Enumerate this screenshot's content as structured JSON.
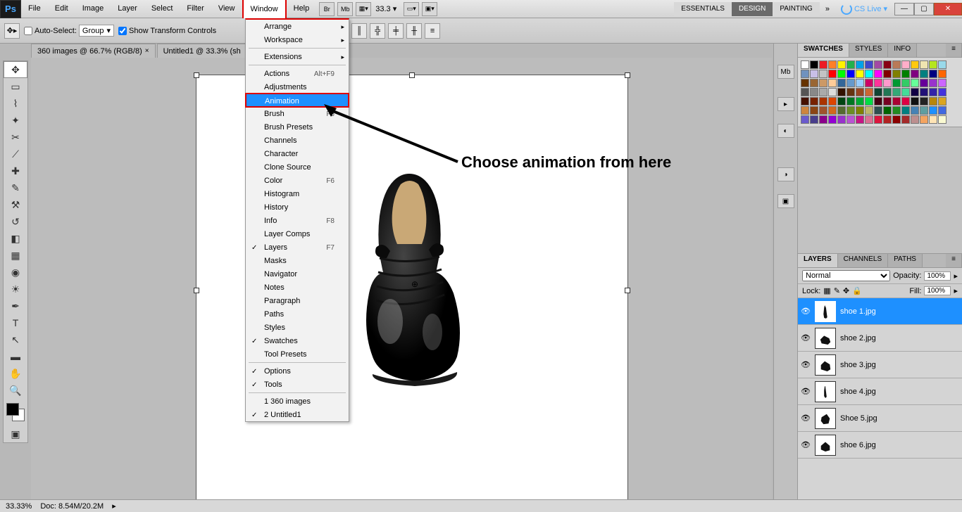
{
  "menubar": {
    "items": [
      "File",
      "Edit",
      "Image",
      "Layer",
      "Select",
      "Filter",
      "View",
      "Window",
      "Help"
    ],
    "active_index": 7,
    "zoom_display": "33.3",
    "workspaces": [
      "ESSENTIALS",
      "DESIGN",
      "PAINTING"
    ],
    "active_workspace_index": 1,
    "cslive": "CS Live",
    "br_icon": "Br",
    "mb_icon": "Mb"
  },
  "optbar": {
    "auto_select": "Auto-Select:",
    "group": "Group",
    "show_transform": "Show Transform Controls"
  },
  "doctabs": [
    {
      "label": "360 images @ 66.7% (RGB/8)"
    },
    {
      "label": "Untitled1 @ 33.3% (sh"
    }
  ],
  "dropdown": {
    "sections": [
      [
        {
          "label": "Arrange",
          "sub": true
        },
        {
          "label": "Workspace",
          "sub": true
        }
      ],
      [
        {
          "label": "Extensions",
          "sub": true
        }
      ],
      [
        {
          "label": "Actions",
          "shortcut": "Alt+F9"
        },
        {
          "label": "Adjustments"
        },
        {
          "label": "Animation",
          "highlight": true
        },
        {
          "label": "Brush",
          "shortcut": "F5"
        },
        {
          "label": "Brush Presets"
        },
        {
          "label": "Channels"
        },
        {
          "label": "Character"
        },
        {
          "label": "Clone Source"
        },
        {
          "label": "Color",
          "shortcut": "F6"
        },
        {
          "label": "Histogram"
        },
        {
          "label": "History"
        },
        {
          "label": "Info",
          "shortcut": "F8"
        },
        {
          "label": "Layer Comps"
        },
        {
          "label": "Layers",
          "shortcut": "F7",
          "check": true
        },
        {
          "label": "Masks"
        },
        {
          "label": "Navigator"
        },
        {
          "label": "Notes"
        },
        {
          "label": "Paragraph"
        },
        {
          "label": "Paths"
        },
        {
          "label": "Styles"
        },
        {
          "label": "Swatches",
          "check": true
        },
        {
          "label": "Tool Presets"
        }
      ],
      [
        {
          "label": "Options",
          "check": true
        },
        {
          "label": "Tools",
          "check": true
        }
      ],
      [
        {
          "label": "1 360 images"
        },
        {
          "label": "2 Untitled1",
          "check": true
        }
      ]
    ]
  },
  "annotation": "Choose animation from here",
  "swatches_panel": {
    "tabs": [
      "SWATCHES",
      "STYLES",
      "INFO"
    ],
    "colors": [
      "#ffffff",
      "#000000",
      "#ed1c24",
      "#ff7f27",
      "#fff200",
      "#22b14c",
      "#00a2e8",
      "#3f48cc",
      "#a349a4",
      "#880015",
      "#b97a57",
      "#ffaec9",
      "#ffc90e",
      "#efe4b0",
      "#b5e61d",
      "#99d9ea",
      "#7092be",
      "#c8bfe7",
      "#c3c3c3",
      "#ff0000",
      "#00ff00",
      "#0000ff",
      "#ffff00",
      "#00ffff",
      "#ff00ff",
      "#800000",
      "#808000",
      "#008000",
      "#800080",
      "#008080",
      "#000080",
      "#ff6600",
      "#663300",
      "#996633",
      "#cc9966",
      "#ffcc99",
      "#336699",
      "#6699cc",
      "#99ccff",
      "#cc0066",
      "#ff3399",
      "#ff99cc",
      "#009933",
      "#33cc66",
      "#66ff99",
      "#660099",
      "#9933cc",
      "#cc66ff",
      "#555555",
      "#888888",
      "#aaaaaa",
      "#dddddd",
      "#331100",
      "#663311",
      "#994422",
      "#cc6633",
      "#114433",
      "#227755",
      "#33aa77",
      "#44dd99",
      "#110044",
      "#221177",
      "#3322aa",
      "#4433dd",
      "#441100",
      "#772200",
      "#aa3300",
      "#dd4400",
      "#004411",
      "#007722",
      "#00aa33",
      "#00dd44",
      "#440011",
      "#770022",
      "#aa0033",
      "#dd0044",
      "#111111",
      "#222222",
      "#b8860b",
      "#daa520",
      "#cd853f",
      "#8b4513",
      "#a0522d",
      "#d2691e",
      "#556b2f",
      "#6b8e23",
      "#808000",
      "#bdb76b",
      "#2f4f4f",
      "#006400",
      "#228b22",
      "#008080",
      "#4682b4",
      "#5f9ea0",
      "#1e90ff",
      "#4169e1",
      "#6a5acd",
      "#483d8b",
      "#8b008b",
      "#9400d3",
      "#9932cc",
      "#ba55d3",
      "#c71585",
      "#db7093",
      "#dc143c",
      "#b22222",
      "#8b0000",
      "#a52a2a",
      "#bc8f8f",
      "#f4a460",
      "#ffe4b5",
      "#fafad2"
    ]
  },
  "layers_panel": {
    "tabs": [
      "LAYERS",
      "CHANNELS",
      "PATHS"
    ],
    "blend_mode": "Normal",
    "opacity_label": "Opacity:",
    "opacity": "100%",
    "lock_label": "Lock:",
    "fill_label": "Fill:",
    "fill": "100%",
    "layers": [
      {
        "name": "shoe 1.jpg",
        "selected": true
      },
      {
        "name": "shoe 2.jpg"
      },
      {
        "name": "shoe 3.jpg"
      },
      {
        "name": "shoe 4.jpg"
      },
      {
        "name": "Shoe 5.jpg"
      },
      {
        "name": "shoe 6.jpg"
      }
    ]
  },
  "status": {
    "zoom": "33.33%",
    "doc": "Doc: 8.54M/20.2M"
  }
}
